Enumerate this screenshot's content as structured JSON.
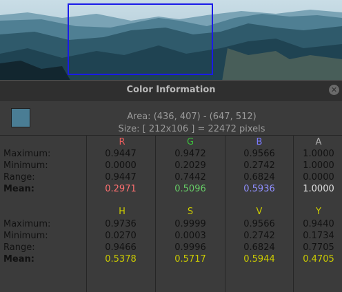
{
  "dialog": {
    "title": "Color Information",
    "area_text": "Area: (436, 407) - (647, 512)",
    "size_text": "Size: [ 212x106 ] = 22472 pixels",
    "swatch_color": "#4a7d94",
    "close_icon": "close-icon"
  },
  "rgb": {
    "headers": [
      "R",
      "G",
      "B",
      "A"
    ],
    "header_colors": [
      "#e85d5d",
      "#3cbf3c",
      "#7a7aff",
      "#b0b0b0"
    ],
    "rows": [
      {
        "label": "Maximum:",
        "values": [
          "0.9447",
          "0.9472",
          "0.9566",
          "1.0000"
        ]
      },
      {
        "label": "Minimum:",
        "values": [
          "0.0000",
          "0.2029",
          "0.2742",
          "1.0000"
        ]
      },
      {
        "label": "Range:",
        "values": [
          "0.9447",
          "0.7442",
          "0.6824",
          "0.0000"
        ]
      },
      {
        "label": "Mean:",
        "values": [
          "0.2971",
          "0.5096",
          "0.5936",
          "1.0000"
        ]
      }
    ],
    "mean_colors": [
      "#ff7070",
      "#66cc66",
      "#8f8fff",
      "#e0e0e0"
    ]
  },
  "hsv": {
    "headers": [
      "H",
      "S",
      "V",
      "Y"
    ],
    "header_color": "#cccc00",
    "rows": [
      {
        "label": "Maximum:",
        "values": [
          "0.9736",
          "0.9999",
          "0.9566",
          "0.9440"
        ]
      },
      {
        "label": "Minimum:",
        "values": [
          "0.0270",
          "0.0003",
          "0.2742",
          "0.1734"
        ]
      },
      {
        "label": "Range:",
        "values": [
          "0.9466",
          "0.9996",
          "0.6824",
          "0.7705"
        ]
      },
      {
        "label": "Mean:",
        "values": [
          "0.5378",
          "0.5717",
          "0.5944",
          "0.4705"
        ]
      }
    ],
    "mean_color": "#cccc00"
  }
}
